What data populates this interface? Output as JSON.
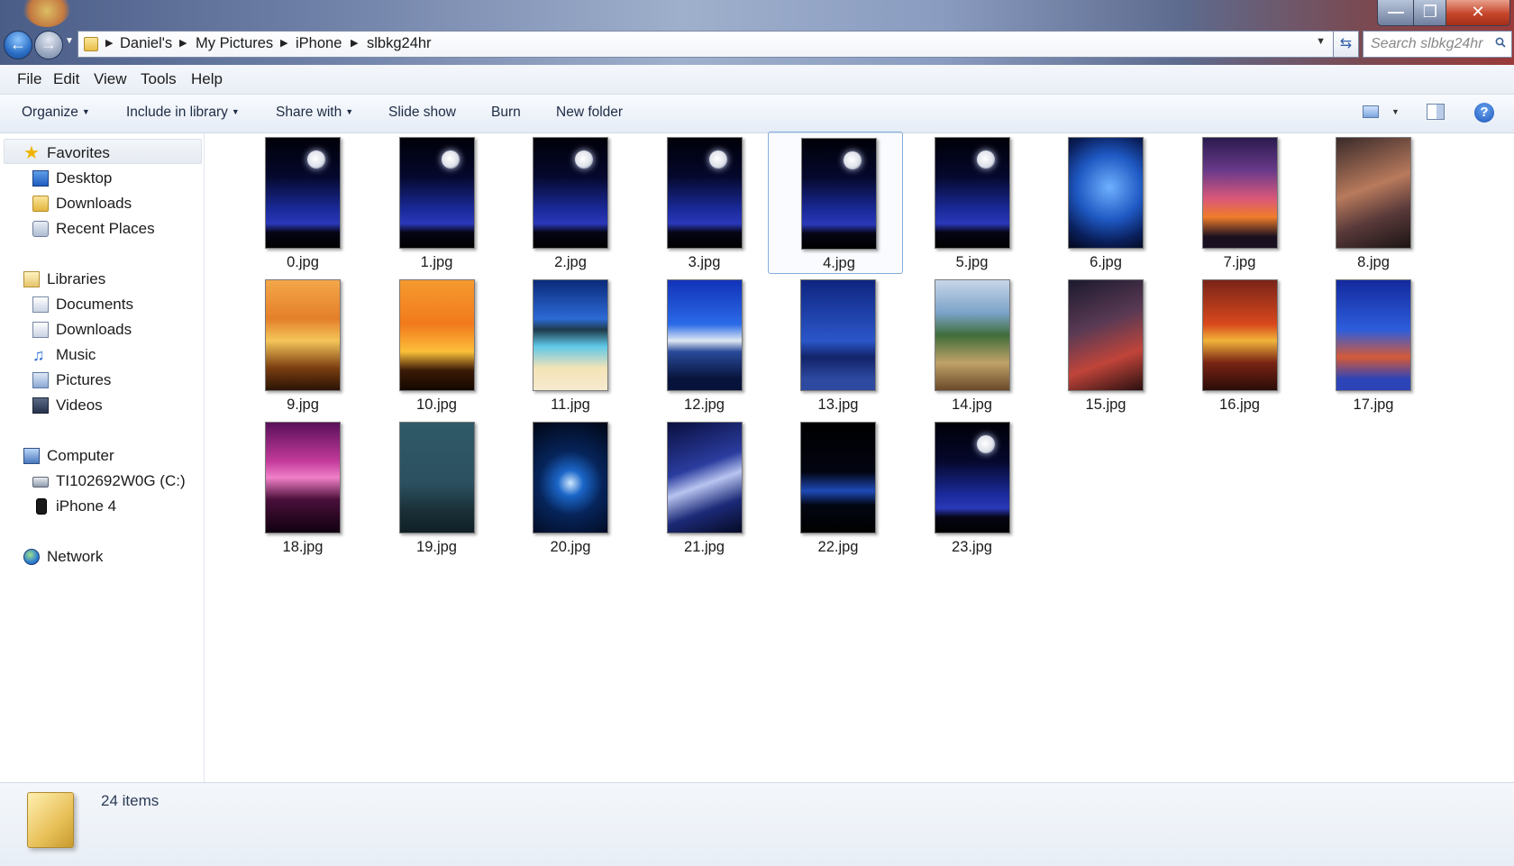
{
  "window": {
    "controls": {
      "minimize": "—",
      "maximize": "❐",
      "close": "✕"
    }
  },
  "address": {
    "breadcrumbs": [
      "Daniel's",
      "My Pictures",
      "iPhone",
      "slbkg24hr"
    ]
  },
  "search": {
    "placeholder": "Search slbkg24hr"
  },
  "menu": [
    "File",
    "Edit",
    "View",
    "Tools",
    "Help"
  ],
  "toolbar": {
    "organize": "Organize",
    "include_in_library": "Include in library",
    "share_with": "Share with",
    "slide_show": "Slide show",
    "burn": "Burn",
    "new_folder": "New folder",
    "help": "?"
  },
  "sidebar": {
    "favorites": {
      "label": "Favorites",
      "items": [
        "Desktop",
        "Downloads",
        "Recent Places"
      ]
    },
    "libraries": {
      "label": "Libraries",
      "items": [
        "Documents",
        "Downloads",
        "Music",
        "Pictures",
        "Videos"
      ]
    },
    "computer": {
      "label": "Computer",
      "items": [
        "TI102692W0G (C:)",
        "iPhone 4"
      ]
    },
    "network": {
      "label": "Network"
    }
  },
  "files": [
    {
      "name": "0.jpg"
    },
    {
      "name": "1.jpg"
    },
    {
      "name": "2.jpg"
    },
    {
      "name": "3.jpg"
    },
    {
      "name": "4.jpg",
      "selected": true
    },
    {
      "name": "5.jpg"
    },
    {
      "name": "6.jpg"
    },
    {
      "name": "7.jpg"
    },
    {
      "name": "8.jpg"
    },
    {
      "name": "9.jpg"
    },
    {
      "name": "10.jpg"
    },
    {
      "name": "11.jpg"
    },
    {
      "name": "12.jpg"
    },
    {
      "name": "13.jpg"
    },
    {
      "name": "14.jpg"
    },
    {
      "name": "15.jpg"
    },
    {
      "name": "16.jpg"
    },
    {
      "name": "17.jpg"
    },
    {
      "name": "18.jpg"
    },
    {
      "name": "19.jpg"
    },
    {
      "name": "20.jpg"
    },
    {
      "name": "21.jpg"
    },
    {
      "name": "22.jpg"
    },
    {
      "name": "23.jpg"
    }
  ],
  "status": {
    "item_count": "24 items"
  }
}
